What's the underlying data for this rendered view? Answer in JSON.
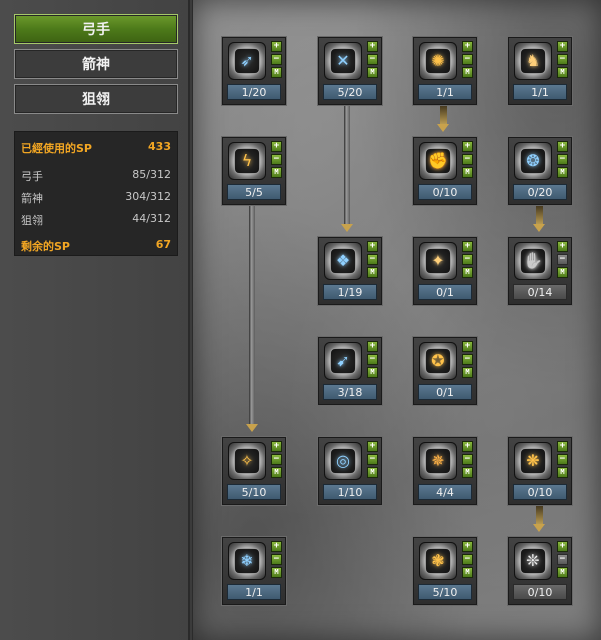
{
  "tabs": [
    {
      "label": "弓手",
      "active": true
    },
    {
      "label": "箭神",
      "active": false
    },
    {
      "label": "狙翎",
      "active": false
    }
  ],
  "sp": {
    "used_label": "已經使用的SP",
    "used_value": "433",
    "rows": [
      {
        "label": "弓手",
        "value": "85/312"
      },
      {
        "label": "箭神",
        "value": "304/312"
      },
      {
        "label": "狙翎",
        "value": "44/312"
      }
    ],
    "remaining_label": "剩余的SP",
    "remaining_value": "67"
  },
  "buttons": {
    "plus": "+",
    "minus": "−",
    "max": "M"
  },
  "skills": [
    {
      "id": "s1",
      "icon": "twin-arrow-icon",
      "glyph": "➶",
      "color": "#8fd0ff",
      "level": "1/20",
      "locked": false
    },
    {
      "id": "s2",
      "icon": "crossed-arrows-icon",
      "glyph": "✕",
      "color": "#8fd0ff",
      "level": "5/20",
      "locked": false
    },
    {
      "id": "s3",
      "icon": "flame-burst-icon",
      "glyph": "✺",
      "color": "#ffc24a",
      "level": "1/1",
      "locked": false
    },
    {
      "id": "s4",
      "icon": "boot-icon",
      "glyph": "♞",
      "color": "#ffd07a",
      "level": "1/1",
      "locked": false
    },
    {
      "id": "s5",
      "icon": "lightning-arrow-icon",
      "glyph": "ϟ",
      "color": "#ffc24a",
      "level": "5/5",
      "locked": false
    },
    {
      "id": "s6",
      "icon": "fire-fist-icon",
      "glyph": "✊",
      "color": "#ffb347",
      "level": "0/10",
      "locked": false
    },
    {
      "id": "s7",
      "icon": "water-drop-icon",
      "glyph": "❂",
      "color": "#8fd0ff",
      "level": "0/20",
      "locked": false
    },
    {
      "id": "s8",
      "icon": "chain-icon",
      "glyph": "❖",
      "color": "#8fd0ff",
      "level": "1/19",
      "locked": false
    },
    {
      "id": "s9",
      "icon": "golden-figure-icon",
      "glyph": "✦",
      "color": "#ffd07a",
      "level": "0/1",
      "locked": false
    },
    {
      "id": "s10",
      "icon": "grey-fist-icon",
      "glyph": "✋",
      "color": "#dddddd",
      "level": "0/14",
      "locked": true
    },
    {
      "id": "s11",
      "icon": "ice-arrow-icon",
      "glyph": "➹",
      "color": "#8fd0ff",
      "level": "3/18",
      "locked": false
    },
    {
      "id": "s12",
      "icon": "fire-kick-icon",
      "glyph": "✪",
      "color": "#ffc24a",
      "level": "0/1",
      "locked": false
    },
    {
      "id": "s13",
      "icon": "golden-dart-icon",
      "glyph": "✧",
      "color": "#ffc24a",
      "level": "5/10",
      "locked": false
    },
    {
      "id": "s14",
      "icon": "water-swirl-icon",
      "glyph": "◎",
      "color": "#8fd0ff",
      "level": "1/10",
      "locked": false
    },
    {
      "id": "s15",
      "icon": "flame-strike-icon",
      "glyph": "✵",
      "color": "#ffb347",
      "level": "4/4",
      "locked": false
    },
    {
      "id": "s16",
      "icon": "fire-eagle-icon",
      "glyph": "❋",
      "color": "#ffc24a",
      "level": "0/10",
      "locked": false
    },
    {
      "id": "s17",
      "icon": "ice-burst-icon",
      "glyph": "❄",
      "color": "#8fd0ff",
      "level": "1/1",
      "locked": false
    },
    {
      "id": "s18",
      "icon": "fire-phoenix-icon",
      "glyph": "❃",
      "color": "#ffc24a",
      "level": "5/10",
      "locked": false
    },
    {
      "id": "s19",
      "icon": "white-eagle-icon",
      "glyph": "❊",
      "color": "#eeeeee",
      "level": "0/10",
      "locked": true
    }
  ]
}
